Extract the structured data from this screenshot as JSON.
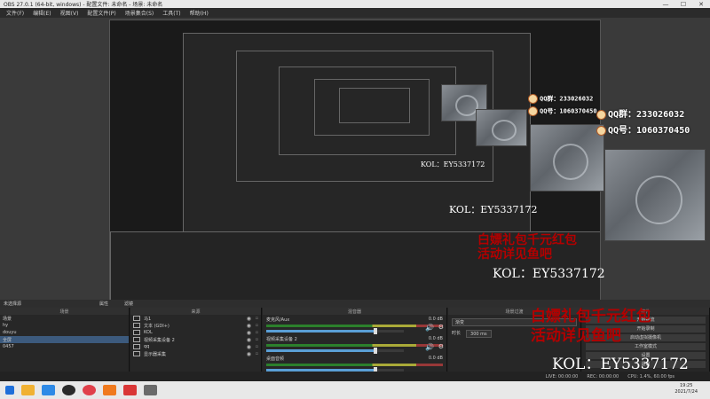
{
  "window": {
    "title": "OBS 27.0.1 (64-bit, windows) - 配置文件: 未命名 - 场景: 未命名",
    "controls": [
      "—",
      "☐",
      "✕"
    ]
  },
  "menu": [
    "文件(F)",
    "编辑(E)",
    "视图(V)",
    "配置文件(P)",
    "场景集合(S)",
    "工具(T)",
    "帮助(H)"
  ],
  "overlays": {
    "promo_line1": "白嫖礼包千元红包",
    "promo_line2": "活动详见鱼吧",
    "kol": "KOL：EY5337172",
    "qq_group": "QQ群：233026032",
    "qq_num": "QQ号：1060370450"
  },
  "scenes_dock": {
    "bar_title": "未选择源",
    "title": "场景",
    "items": [
      "场景",
      "hy",
      "douyu",
      "全屏",
      "0457"
    ],
    "selected_index": 3,
    "props_button": "属性",
    "filters_button": "滤镜"
  },
  "sources_dock": {
    "title": "来源",
    "items": [
      "马1",
      "文本 (GDI+)",
      "KOL",
      "视频采集设备 2",
      "qq",
      "显示器采集"
    ]
  },
  "mixer_dock": {
    "title": "混音器",
    "channels": [
      {
        "name": "麦克风/Aux",
        "db": "0.0 dB",
        "level": 0.8
      },
      {
        "name": "视频采集设备 2",
        "db": "0.0 dB",
        "level": 0.8
      },
      {
        "name": "桌面音频",
        "db": "0.0 dB",
        "level": 0.8
      }
    ]
  },
  "transitions_dock": {
    "title": "场景过渡",
    "current": "渐变",
    "duration_label": "时长",
    "duration_value": "300 ms"
  },
  "controls_dock": {
    "title": "控件",
    "buttons": [
      "开始推流",
      "开始录制",
      "启动虚拟摄像机",
      "工作室模式",
      "设置",
      "退出"
    ]
  },
  "status": {
    "live": "LIVE: 00:00:00",
    "rec": "REC: 00:00:00",
    "cpu": "CPU: 1.4%, 60.00 fps"
  },
  "taskbar": {
    "time": "19:25",
    "date": "2021/7/24"
  }
}
